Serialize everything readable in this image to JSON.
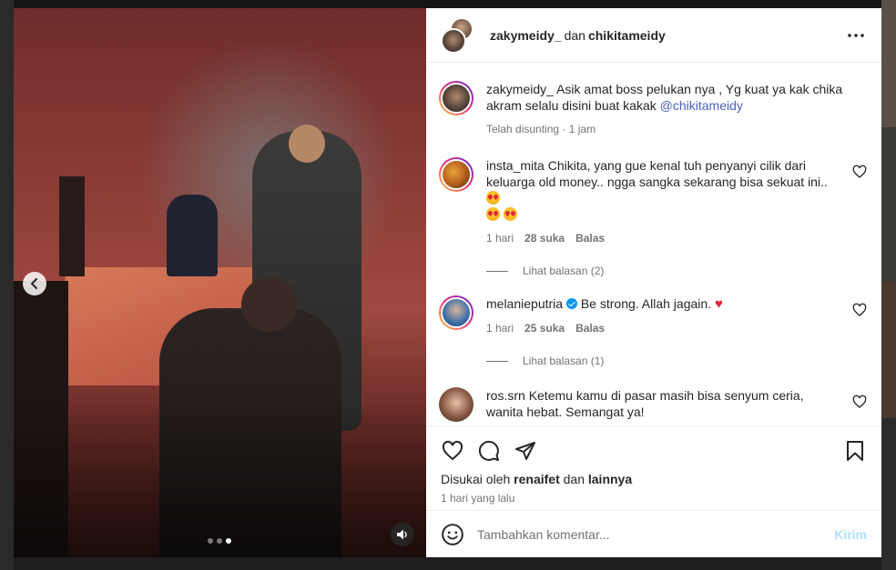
{
  "header": {
    "user1": "zakymeidy_",
    "separator": "dan",
    "user2": "chikitameidy",
    "more_icon": "more-horizontal-icon"
  },
  "caption": {
    "username": "zakymeidy_",
    "text": "Asik amat boss pelukan nya , Yg kuat ya kak chika akram selalu disini buat kakak ",
    "mention": "@chikitameidy",
    "meta": "Telah disunting · 1 jam"
  },
  "comments": [
    {
      "username": "insta_mita",
      "text": "Chikita, yang gue kenal tuh penyanyi cilik dari keluarga old money.. ngga sangka sekarang bisa sekuat ini..",
      "time": "1 hari",
      "likes": "28 suka",
      "reply": "Balas",
      "replies_label": "Lihat balasan (2)"
    },
    {
      "username": "melanieputria",
      "text": "Be strong. Allah jagain.",
      "time": "1 hari",
      "likes": "25 suka",
      "reply": "Balas",
      "replies_label": "Lihat balasan (1)"
    },
    {
      "username": "ros.srn",
      "text": "Ketemu kamu di pasar masih bisa senyum ceria, wanita hebat. Semangat ya!"
    }
  ],
  "likes": {
    "prefix": "Disukai oleh",
    "user": "renaifet",
    "joiner": "dan",
    "others": "lainnya"
  },
  "post_time": "1 hari yang lalu",
  "add_comment": {
    "placeholder": "Tambahkan komentar...",
    "post_label": "Kirim"
  },
  "media": {
    "slide_count": 3,
    "active_slide": 3
  }
}
